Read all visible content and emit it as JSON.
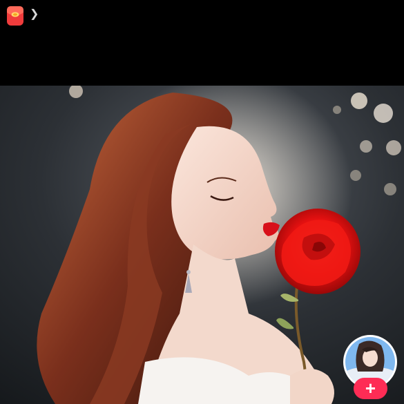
{
  "header": {
    "red_packet_icon": "red-envelope-icon",
    "chevron_glyph": "❯"
  },
  "photo": {
    "subject": "illustration-woman-with-red-rose"
  },
  "sidebar": {
    "avatar_icon": "creator-avatar",
    "follow_glyph": "+",
    "follow_color": "#fe2c55"
  },
  "colors": {
    "background": "#000000",
    "accent": "#fe2c55",
    "rose": "#e31010"
  }
}
